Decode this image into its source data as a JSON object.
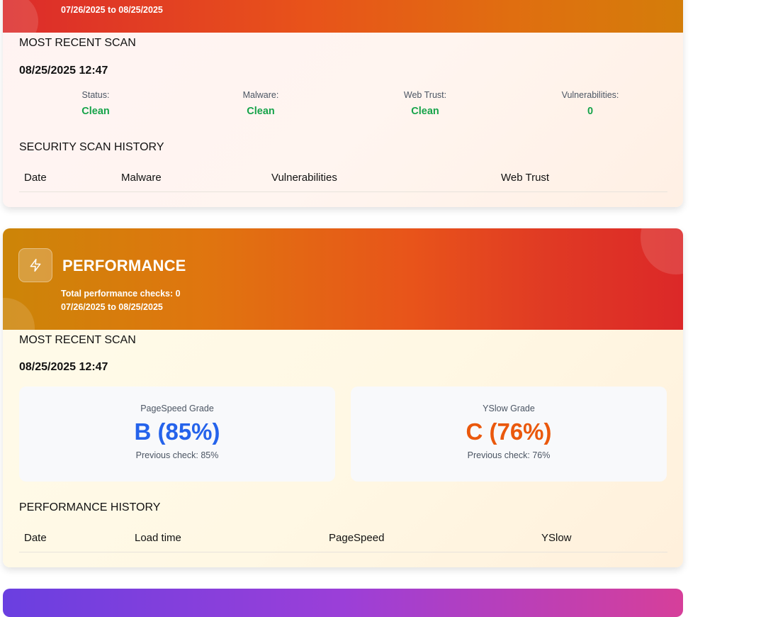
{
  "security": {
    "date_range": "07/26/2025 to 08/25/2025",
    "most_recent_title": "MOST RECENT SCAN",
    "scan_date": "08/25/2025 12:47",
    "stats": [
      {
        "label": "Status:",
        "value": "Clean"
      },
      {
        "label": "Malware:",
        "value": "Clean"
      },
      {
        "label": "Web Trust:",
        "value": "Clean"
      },
      {
        "label": "Vulnerabilities:",
        "value": "0"
      }
    ],
    "history_title": "SECURITY SCAN HISTORY",
    "history_columns": [
      "Date",
      "Malware",
      "Vulnerabilities",
      "Web Trust"
    ]
  },
  "performance": {
    "title": "PERFORMANCE",
    "total_checks": "Total performance checks: 0",
    "date_range": "07/26/2025 to 08/25/2025",
    "icon": "lightning-icon",
    "most_recent_title": "MOST RECENT SCAN",
    "scan_date": "08/25/2025 12:47",
    "pagespeed": {
      "label": "PageSpeed Grade",
      "value": "B (85%)",
      "previous": "Previous check: 85%",
      "color": "#2563eb"
    },
    "yslow": {
      "label": "YSlow Grade",
      "value": "C (76%)",
      "previous": "Previous check: 76%",
      "color": "#ea580c"
    },
    "history_title": "PERFORMANCE HISTORY",
    "history_columns": [
      "Date",
      "Load time",
      "PageSpeed",
      "YSlow"
    ]
  },
  "colors": {
    "clean": "#16a34a",
    "security_header": "#e8531a",
    "performance_header": "#e0750f"
  }
}
